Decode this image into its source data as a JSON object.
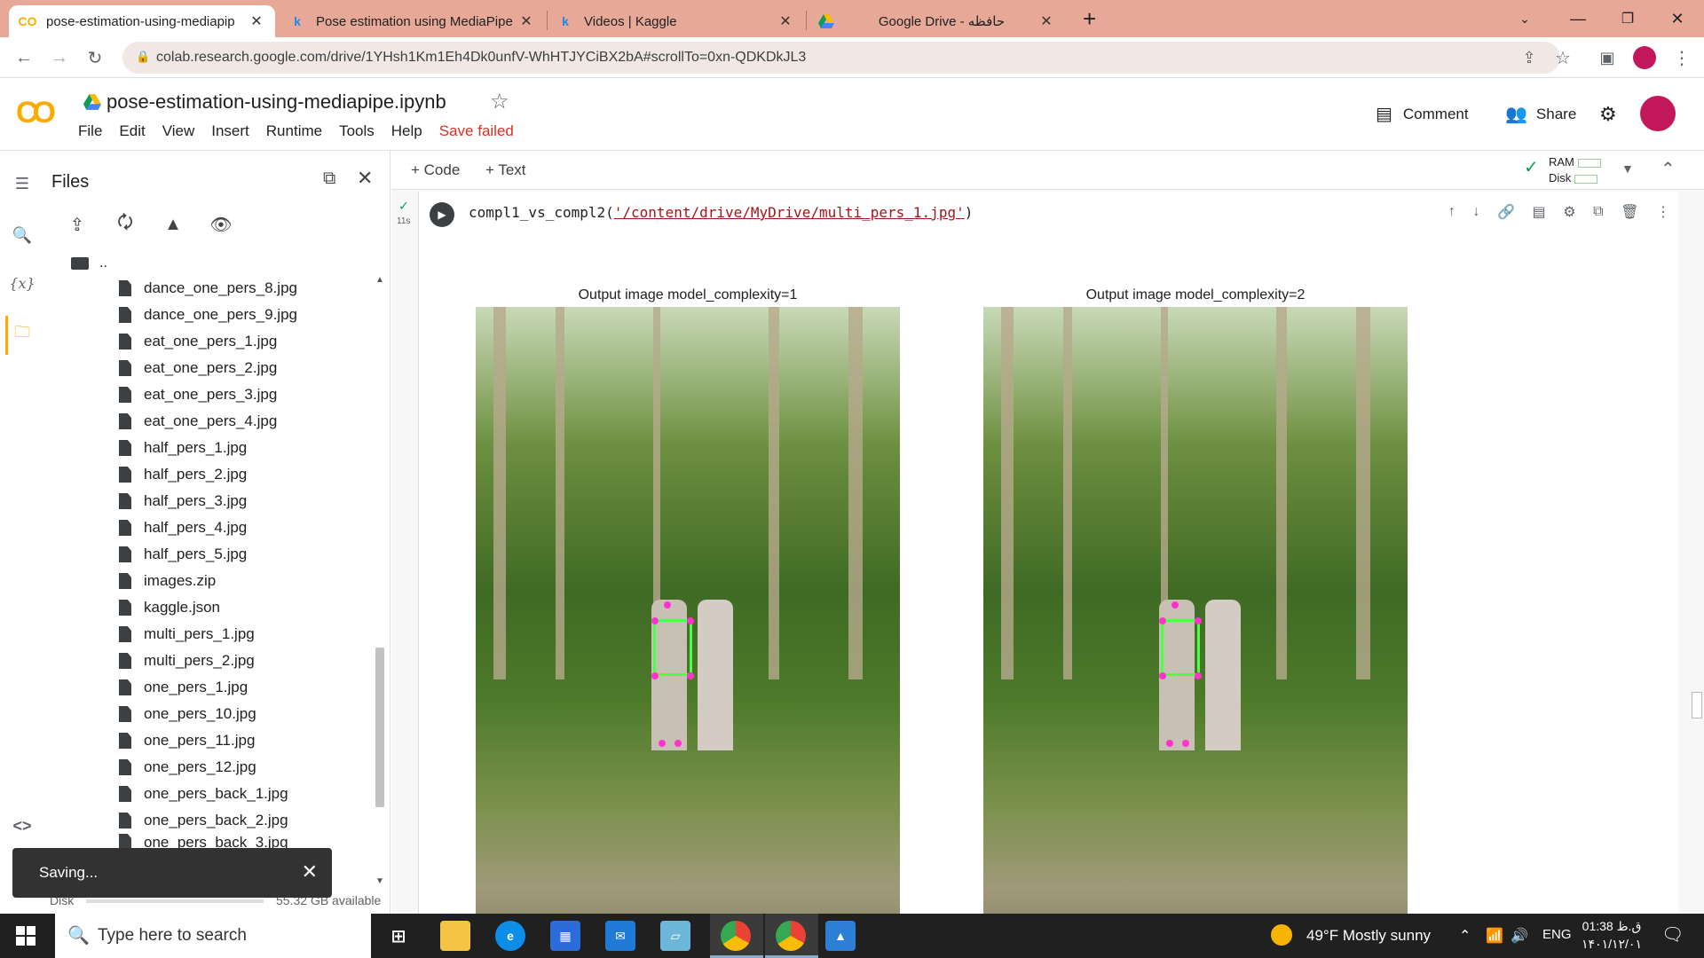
{
  "browser": {
    "tabs": [
      {
        "title": "pose-estimation-using-mediapip",
        "active": true
      },
      {
        "title": "Pose estimation using MediaPipe"
      },
      {
        "title": "Videos | Kaggle"
      },
      {
        "title": "Google Drive - حافظه"
      }
    ],
    "url": "colab.research.google.com/drive/1YHsh1Km1Eh4Dk0unfV-WhHTJYCiBX2bA#scrollTo=0xn-QDKDkJL3"
  },
  "colab": {
    "notebook_title": "pose-estimation-using-mediapipe.ipynb",
    "menu": [
      "File",
      "Edit",
      "View",
      "Insert",
      "Runtime",
      "Tools",
      "Help"
    ],
    "save_status": "Save failed",
    "comment_label": "Comment",
    "share_label": "Share"
  },
  "files": {
    "title": "Files",
    "parent": "..",
    "items": [
      "dance_one_pers_8.jpg",
      "dance_one_pers_9.jpg",
      "eat_one_pers_1.jpg",
      "eat_one_pers_2.jpg",
      "eat_one_pers_3.jpg",
      "eat_one_pers_4.jpg",
      "half_pers_1.jpg",
      "half_pers_2.jpg",
      "half_pers_3.jpg",
      "half_pers_4.jpg",
      "half_pers_5.jpg",
      "images.zip",
      "kaggle.json",
      "multi_pers_1.jpg",
      "multi_pers_2.jpg",
      "one_pers_1.jpg",
      "one_pers_10.jpg",
      "one_pers_11.jpg",
      "one_pers_12.jpg",
      "one_pers_back_1.jpg",
      "one_pers_back_2.jpg",
      "one_pers_back_3.jpg"
    ],
    "disk_label": "Disk",
    "disk_available": "55.32 GB available"
  },
  "toolbar": {
    "add_code": "+ Code",
    "add_text": "+ Text",
    "ram_label": "RAM",
    "disk_label": "Disk"
  },
  "cell": {
    "exec_time": "11s",
    "code_fn": "compl1_vs_compl2(",
    "code_arg": "'/content/drive/MyDrive/multi_pers_1.jpg'",
    "code_end": ")",
    "output_title_1": "Output image model_complexity=1",
    "output_title_2": "Output image model_complexity=2"
  },
  "toast": {
    "text": "Saving..."
  },
  "taskbar": {
    "search_placeholder": "Type here to search",
    "weather": "49°F  Mostly sunny",
    "lang": "ENG",
    "time": "01:38 ق.ظ",
    "date": "۱۴۰۱/۱۲/۰۱"
  },
  "colors": {
    "accent": "#f9ab00",
    "save_failed": "#d93025",
    "pose_lines": "#4cff4c",
    "pose_points": "#ff33cc"
  }
}
